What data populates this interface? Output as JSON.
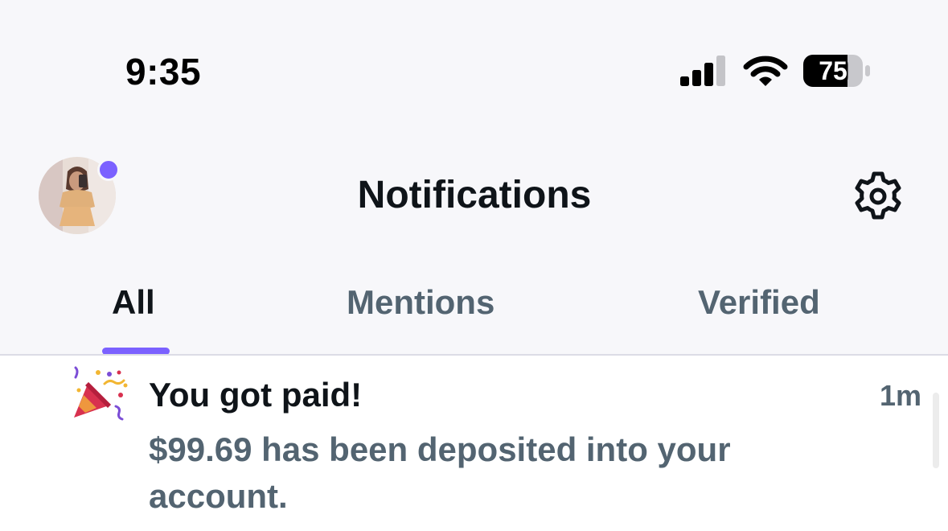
{
  "status_bar": {
    "time": "9:35",
    "battery_level": "75",
    "battery_percent": 75,
    "signal_bars_active": 3,
    "signal_bars_total": 4,
    "icons": [
      "signal-icon",
      "wifi-icon",
      "battery-icon"
    ]
  },
  "header": {
    "title": "Notifications",
    "avatar": "profile-avatar",
    "has_unread_dot": true,
    "settings_icon": "gear-icon"
  },
  "tabs": [
    {
      "label": "All",
      "active": true
    },
    {
      "label": "Mentions",
      "active": false
    },
    {
      "label": "Verified",
      "active": false
    }
  ],
  "notifications": [
    {
      "icon": "party-popper-icon",
      "title": "You got paid!",
      "body": "$99.69 has been deposited into your account.",
      "time": "1m"
    }
  ],
  "colors": {
    "accent": "#7b61ff",
    "text_primary": "#0f1419",
    "text_secondary": "#536471",
    "header_bg": "#f7f7fa"
  }
}
